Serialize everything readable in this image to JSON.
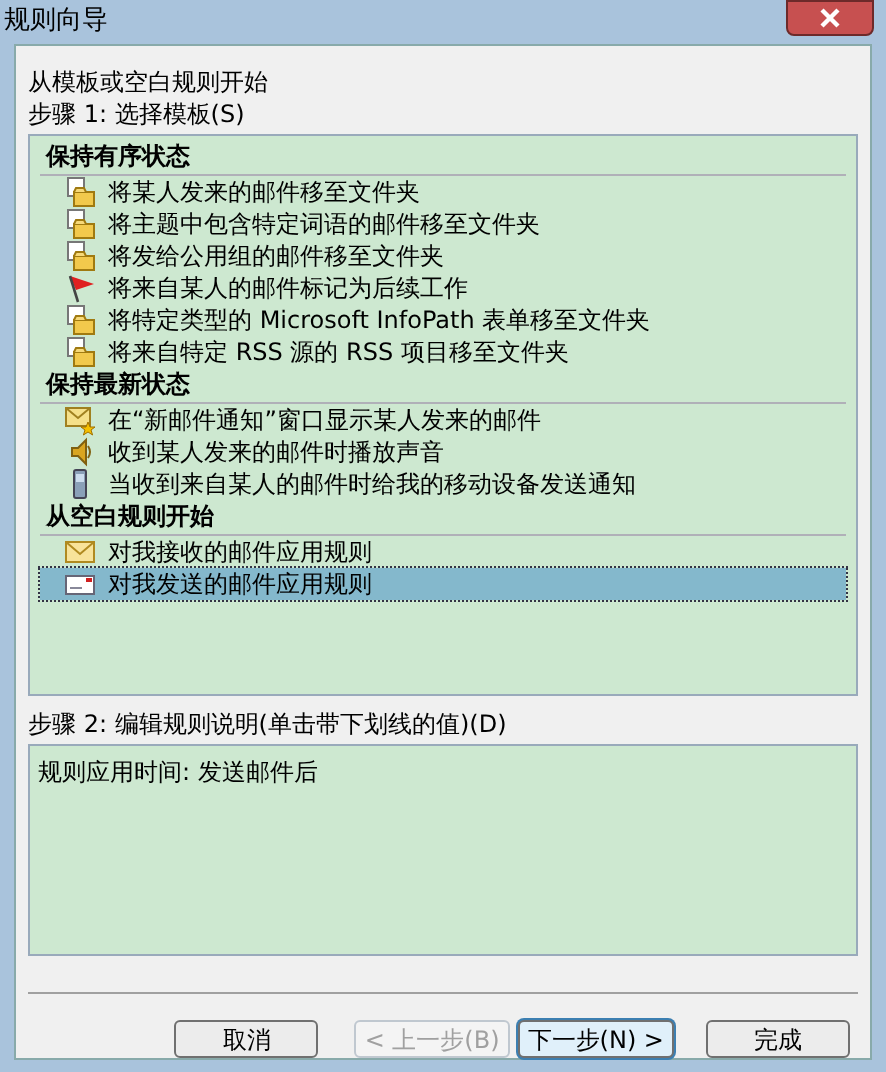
{
  "window": {
    "title": "规则向导"
  },
  "intro": "从模板或空白规则开始",
  "step1": "步骤 1: 选择模板(S)",
  "groups": [
    {
      "header": "保持有序状态",
      "items": [
        {
          "label": "将某人发来的邮件移至文件夹",
          "kind": "move",
          "selected": false
        },
        {
          "label": "将主题中包含特定词语的邮件移至文件夹",
          "kind": "move",
          "selected": false
        },
        {
          "label": "将发给公用组的邮件移至文件夹",
          "kind": "move",
          "selected": false
        },
        {
          "label": "将来自某人的邮件标记为后续工作",
          "kind": "flag",
          "selected": false
        },
        {
          "label": "将特定类型的 Microsoft InfoPath 表单移至文件夹",
          "kind": "move",
          "selected": false
        },
        {
          "label": "将来自特定 RSS 源的 RSS 项目移至文件夹",
          "kind": "move",
          "selected": false
        }
      ]
    },
    {
      "header": "保持最新状态",
      "items": [
        {
          "label": "在“新邮件通知”窗口显示某人发来的邮件",
          "kind": "alert",
          "selected": false
        },
        {
          "label": "收到某人发来的邮件时播放声音",
          "kind": "sound",
          "selected": false
        },
        {
          "label": "当收到来自某人的邮件时给我的移动设备发送通知",
          "kind": "mobile",
          "selected": false
        }
      ]
    },
    {
      "header": "从空白规则开始",
      "items": [
        {
          "label": "对我接收的邮件应用规则",
          "kind": "inbox",
          "selected": false
        },
        {
          "label": "对我发送的邮件应用规则",
          "kind": "outbox",
          "selected": true
        }
      ]
    }
  ],
  "step2": "步骤 2: 编辑规则说明(单击带下划线的值)(D)",
  "description": "规则应用时间: 发送邮件后",
  "buttons": [
    {
      "label": "取消",
      "disabled": false,
      "default": false
    },
    {
      "label": "< 上一步(B)",
      "disabled": true,
      "default": false
    },
    {
      "label": "下一步(N) >",
      "disabled": false,
      "default": true
    },
    {
      "label": "完成",
      "disabled": false,
      "default": false
    }
  ]
}
